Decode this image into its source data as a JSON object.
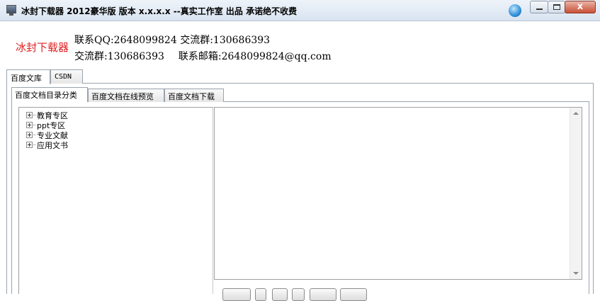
{
  "window": {
    "title": "冰封下载器 2012豪华版  版本 x.x.x.x --真实工作室 出品  承诺绝不收费",
    "controls": {
      "minimize": "",
      "maximize": "",
      "close": "x"
    }
  },
  "header": {
    "brand": "冰封下载器",
    "line1": "联系QQ:2648099824 交流群:130686393",
    "line2a": "交流群:130686393",
    "line2b": "联系邮箱:2648099824@qq.com"
  },
  "outer_tabs": [
    "百度文库",
    "CSDN"
  ],
  "inner_tabs": [
    "百度文档目录分类",
    "百度文档在线预览",
    "百度文档下载"
  ],
  "tree": {
    "items": [
      "教育专区",
      "ppt专区",
      "专业文献",
      "应用文书"
    ]
  },
  "icons": {
    "app": "window-app-icon",
    "orb": "blue-orb-icon",
    "expand": "plus-expander-icon",
    "scroll_up": "scroll-up-arrow-icon",
    "scroll_down": "scroll-down-arrow-icon"
  }
}
